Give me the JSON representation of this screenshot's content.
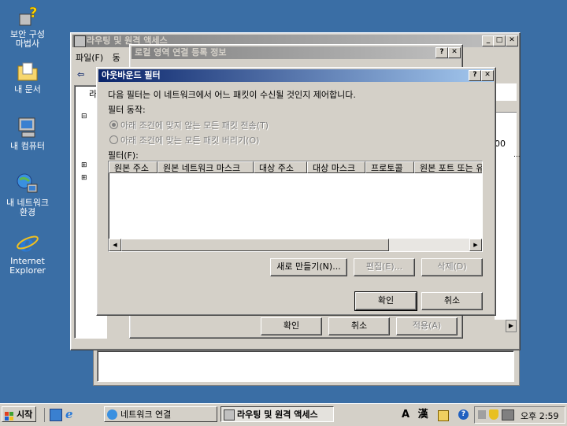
{
  "desktop": {
    "icons": [
      {
        "label": "보안 구성\n마법사",
        "icon": "security-wizard-icon"
      },
      {
        "label": "내 문서",
        "icon": "folder-icon"
      },
      {
        "label": "내 컴퓨터",
        "icon": "computer-icon"
      },
      {
        "label": "내 네트워크\n환경",
        "icon": "network-icon"
      },
      {
        "label": "Internet\nExplorer",
        "icon": "ie-icon"
      }
    ]
  },
  "rras": {
    "title": "라우팅 및 원격 액세스",
    "menu": [
      "파일(F)",
      "동"
    ],
    "tree_fragment": "라"
  },
  "local_area": {
    "title": "로컬 영역 연결 등록 정보",
    "buttons": {
      "ok": "확인",
      "cancel": "취소",
      "apply": "적용(A)"
    },
    "fragments": [
      "00",
      "..."
    ]
  },
  "outbound": {
    "title": "아웃바운드 필터",
    "description": "다음 필터는 이 네트워크에서 어느 패킷이 수신될 것인지 제어합니다.",
    "action_label": "필터 동작:",
    "radio1": "아래 조건에 맞지 않는 모든 패킷 전송(T)",
    "radio2": "아래 조건에 맞는 모든 패킷 버리기(O)",
    "filters_label": "필터(F):",
    "columns": [
      "원본 주소",
      "원본 네트워크 마스크",
      "대상 주소",
      "대상 마스크",
      "프로토콜",
      "원본 포트 또는 유"
    ],
    "buttons": {
      "new": "새로 만들기(N)...",
      "edit": "편집(E)...",
      "delete": "삭제(D)",
      "ok": "확인",
      "cancel": "취소"
    }
  },
  "taskbar": {
    "start": "시작",
    "tasks": [
      "네트워크 연결",
      "라우팅 및 원격 액세스"
    ],
    "ime": [
      "A",
      "漢"
    ],
    "clock": "오후 2:59"
  }
}
